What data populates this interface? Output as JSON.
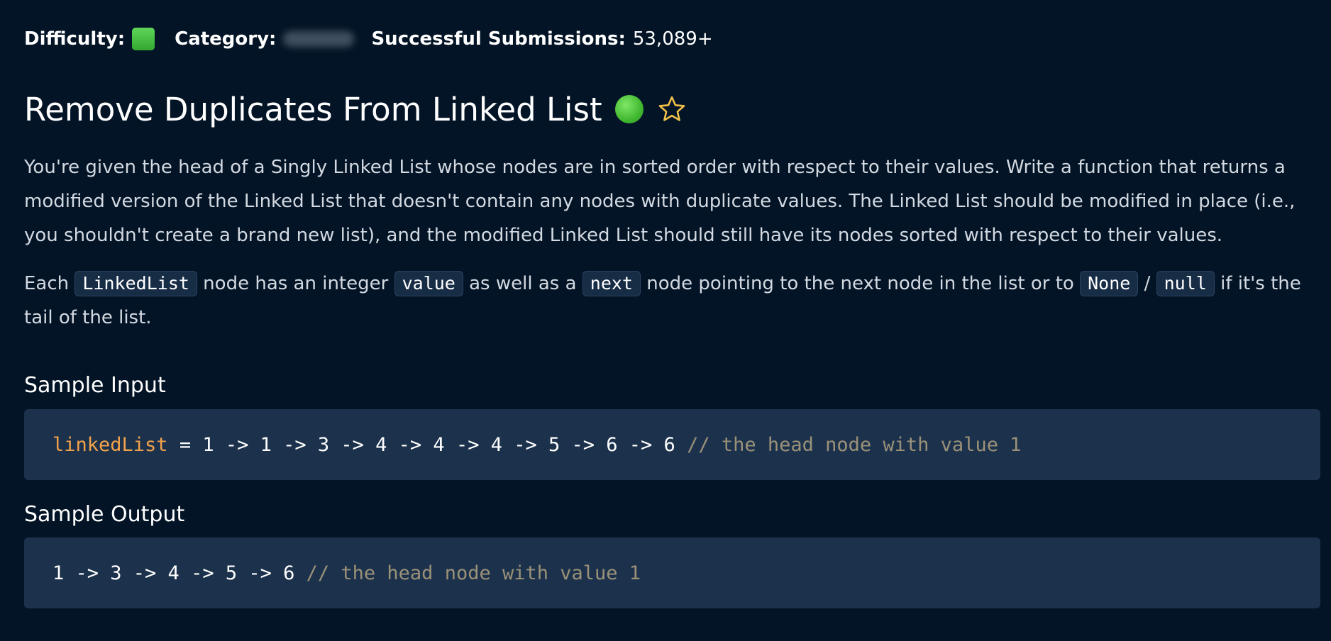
{
  "meta": {
    "difficulty_label": "Difficulty:",
    "category_label": "Category:",
    "submissions_label": "Successful Submissions:",
    "submissions_value": "53,089+",
    "colors": {
      "difficulty_green": "#4cc445",
      "star_outline": "#f2c14a",
      "background": "#031426",
      "code_background": "#1c324c"
    }
  },
  "problem": {
    "title": "Remove Duplicates From Linked List",
    "status_icon": "green-dot-icon",
    "favorite_icon": "star-outline-icon",
    "description_p1": "You're given the head of a Singly Linked List whose nodes are in sorted order with respect to their values. Write a function that returns a modified version of the Linked List that doesn't contain any nodes with duplicate values. The Linked List should be modified in place (i.e., you shouldn't create a brand new list), and the modified Linked List should still have its nodes sorted with respect to their values.",
    "description_p2": {
      "part1": "Each ",
      "code1": "LinkedList",
      "part2": " node has an integer ",
      "code2": "value",
      "part3": " as well as a ",
      "code3": "next",
      "part4": " node pointing to the next node in the list or to ",
      "code4": "None",
      "part5": " / ",
      "code5": "null",
      "part6": " if it's the tail of the list."
    }
  },
  "sample_input": {
    "heading": "Sample Input",
    "var_name": "linkedList",
    "code": " = 1 -> 1 -> 3 -> 4 -> 4 -> 4 -> 5 -> 6 -> 6 ",
    "comment": "// the head node with value 1"
  },
  "sample_output": {
    "heading": "Sample Output",
    "code": "1 -> 3 -> 4 -> 5 -> 6 ",
    "comment": "// the head node with value 1"
  }
}
